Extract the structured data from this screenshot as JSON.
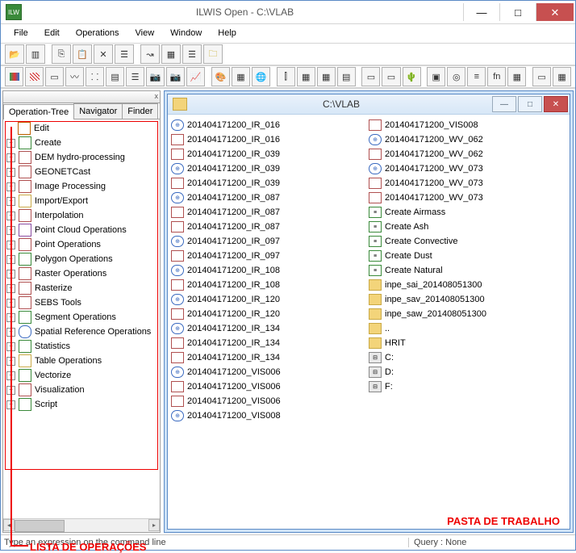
{
  "window": {
    "title": "ILWIS Open - C:\\VLAB",
    "logo_text": "ILW"
  },
  "menu": [
    "File",
    "Edit",
    "Operations",
    "View",
    "Window",
    "Help"
  ],
  "sysbuttons": {
    "min": "—",
    "max": "□",
    "close": "✕"
  },
  "sidebar": {
    "close_x": "x",
    "tabs": [
      "Operation-Tree",
      "Navigator",
      "Finder"
    ],
    "active_tab": 0,
    "items": [
      {
        "label": "Edit",
        "icon": "edit",
        "cls": "ic-edit"
      },
      {
        "label": "Create",
        "icon": "create",
        "cls": "ic-grn"
      },
      {
        "label": "DEM hydro-processing",
        "icon": "dem",
        "cls": "ic-red"
      },
      {
        "label": "GEONETCast",
        "icon": "geonet",
        "cls": "ic-red"
      },
      {
        "label": "Image Processing",
        "icon": "imgproc",
        "cls": "ic-red"
      },
      {
        "label": "Import/Export",
        "icon": "impexp",
        "cls": "ic-yel"
      },
      {
        "label": "Interpolation",
        "icon": "interp",
        "cls": "ic-red"
      },
      {
        "label": "Point Cloud Operations",
        "icon": "ptcloud",
        "cls": "ic-pur"
      },
      {
        "label": "Point Operations",
        "icon": "ptops",
        "cls": "ic-red"
      },
      {
        "label": "Polygon Operations",
        "icon": "polyops",
        "cls": "ic-grn"
      },
      {
        "label": "Raster Operations",
        "icon": "rastops",
        "cls": "ic-red"
      },
      {
        "label": "Rasterize",
        "icon": "rasterize",
        "cls": "ic-red"
      },
      {
        "label": "SEBS Tools",
        "icon": "sebs",
        "cls": "ic-red"
      },
      {
        "label": "Segment Operations",
        "icon": "segops",
        "cls": "ic-grn"
      },
      {
        "label": "Spatial Reference Operations",
        "icon": "srs",
        "cls": "ic-blu"
      },
      {
        "label": "Statistics",
        "icon": "stats",
        "cls": "ic-grn"
      },
      {
        "label": "Table Operations",
        "icon": "tblops",
        "cls": "ic-yel"
      },
      {
        "label": "Vectorize",
        "icon": "vectorize",
        "cls": "ic-grn"
      },
      {
        "label": "Visualization",
        "icon": "viz",
        "cls": "ic-red"
      },
      {
        "label": "Script",
        "icon": "script",
        "cls": "ic-grn"
      }
    ]
  },
  "folderview": {
    "title": "C:\\VLAB",
    "col1": [
      {
        "name": "201404171200_IR_016",
        "icon": "globe"
      },
      {
        "name": "201404171200_IR_016",
        "icon": "rm"
      },
      {
        "name": "201404171200_IR_039",
        "icon": "rs"
      },
      {
        "name": "201404171200_IR_039",
        "icon": "globe"
      },
      {
        "name": "201404171200_IR_039",
        "icon": "rm"
      },
      {
        "name": "201404171200_IR_087",
        "icon": "globe"
      },
      {
        "name": "201404171200_IR_087",
        "icon": "rm"
      },
      {
        "name": "201404171200_IR_087",
        "icon": "rs"
      },
      {
        "name": "201404171200_IR_097",
        "icon": "globe"
      },
      {
        "name": "201404171200_IR_097",
        "icon": "rm"
      },
      {
        "name": "201404171200_IR_108",
        "icon": "globe"
      },
      {
        "name": "201404171200_IR_108",
        "icon": "rm"
      },
      {
        "name": "201404171200_IR_120",
        "icon": "globe"
      },
      {
        "name": "201404171200_IR_120",
        "icon": "rm"
      },
      {
        "name": "201404171200_IR_134",
        "icon": "globe"
      },
      {
        "name": "201404171200_IR_134",
        "icon": "rm"
      },
      {
        "name": "201404171200_IR_134",
        "icon": "rs"
      },
      {
        "name": "201404171200_VIS006",
        "icon": "globe"
      },
      {
        "name": "201404171200_VIS006",
        "icon": "rm"
      },
      {
        "name": "201404171200_VIS006",
        "icon": "rs"
      },
      {
        "name": "201404171200_VIS008",
        "icon": "globe"
      }
    ],
    "col2": [
      {
        "name": "201404171200_VIS008",
        "icon": "rm"
      },
      {
        "name": "201404171200_WV_062",
        "icon": "globe"
      },
      {
        "name": "201404171200_WV_062",
        "icon": "rm"
      },
      {
        "name": "201404171200_WV_073",
        "icon": "globe"
      },
      {
        "name": "201404171200_WV_073",
        "icon": "rm"
      },
      {
        "name": "201404171200_WV_073",
        "icon": "rs"
      },
      {
        "name": "Create Airmass",
        "icon": "scr"
      },
      {
        "name": "Create Ash",
        "icon": "scr"
      },
      {
        "name": "Create Convective",
        "icon": "scr"
      },
      {
        "name": "Create Dust",
        "icon": "scr"
      },
      {
        "name": "Create Natural",
        "icon": "scr"
      },
      {
        "name": "inpe_sai_201408051300",
        "icon": "fol2"
      },
      {
        "name": "inpe_sav_201408051300",
        "icon": "fol2"
      },
      {
        "name": "inpe_saw_201408051300",
        "icon": "fol2"
      },
      {
        "name": "..",
        "icon": "fol"
      },
      {
        "name": "HRIT",
        "icon": "fol"
      },
      {
        "name": "C:",
        "icon": "drv"
      },
      {
        "name": "D:",
        "icon": "drv"
      },
      {
        "name": "F:",
        "icon": "drv"
      }
    ]
  },
  "status": {
    "left": "Type an expression on the command line",
    "right": "Query : None"
  },
  "annotations": {
    "pasta": "PASTA DE TRABALHO",
    "lista": "LISTA DE OPERAÇÕES"
  }
}
